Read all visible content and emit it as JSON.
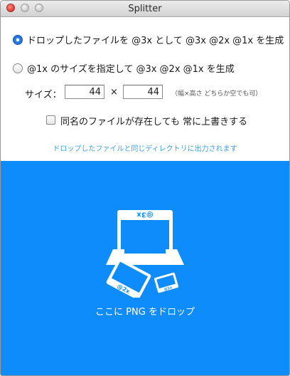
{
  "window": {
    "title": "Splitter"
  },
  "options": {
    "mode_drop": {
      "label": "ドロップしたファイルを @3x として @3x @2x @1x を生成",
      "selected": true
    },
    "mode_size": {
      "label": "@1x のサイズを指定して @3x @2x @1x を生成",
      "selected": false
    }
  },
  "size": {
    "label": "サイズ：",
    "width": "44",
    "times": "×",
    "height": "44",
    "hint": "（幅×高さ どちらか空でも可）"
  },
  "overwrite": {
    "label": "同名のファイルが存在しても 常に上書きする",
    "checked": false
  },
  "note": "ドロップしたファイルと同じディレクトリに出力されます",
  "dropzone": {
    "label": "ここに PNG をドロップ",
    "bg_color": "#0f8cfb",
    "badge_3x": "@3x",
    "badge_2x": "@2x",
    "badge_1x": "@1x"
  },
  "colors": {
    "accent": "#0f8cfb",
    "note": "#3fa0e8"
  }
}
